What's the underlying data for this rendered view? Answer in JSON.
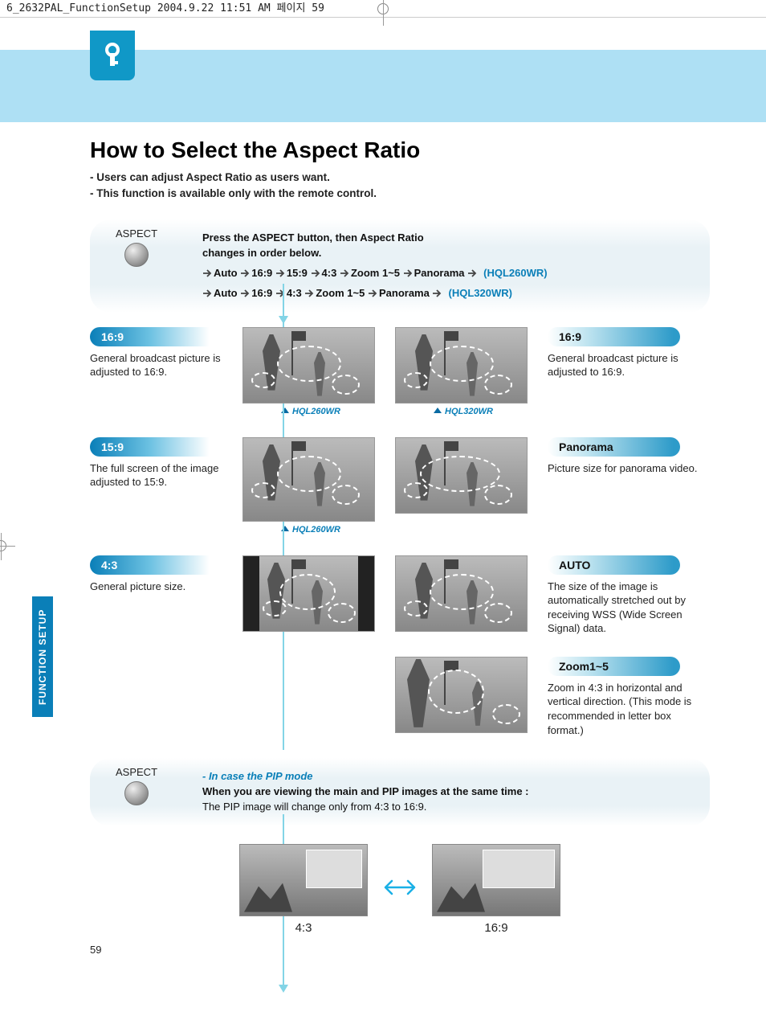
{
  "crop_mark": "6_2632PAL_FunctionSetup  2004.9.22 11:51 AM  페이지 59",
  "title": "How to Select the Aspect Ratio",
  "intro_l1": "- Users can adjust Aspect Ratio as users want.",
  "intro_l2": "- This function is available only with the remote control.",
  "aspect_label": "ASPECT",
  "panel1_l1": "Press the ASPECT button, then Aspect Ratio",
  "panel1_l2": "changes in order below.",
  "seq1": {
    "a": "Auto",
    "b": "16:9",
    "c": "15:9",
    "d": "4:3",
    "e": "Zoom 1~5",
    "f": "Panorama",
    "model": "(HQL260WR)"
  },
  "seq2": {
    "a": "Auto",
    "b": "16:9",
    "c": "4:3",
    "d": "Zoom 1~5",
    "e": "Panorama",
    "model": "(HQL320WR)"
  },
  "left": {
    "r1_t": "16:9",
    "r1_d": "General broadcast picture is adjusted to 16:9.",
    "r2_t": "15:9",
    "r2_d": "The full screen of the image adjusted to 15:9.",
    "r3_t": "4:3",
    "r3_d": "General picture size."
  },
  "right": {
    "r1_t": "16:9",
    "r1_d": "General broadcast picture is adjusted to 16:9.",
    "r2_t": "Panorama",
    "r2_d": "Picture size for panorama video.",
    "r3_t": "AUTO",
    "r3_d": "The size of the image is automatically stretched out by receiving WSS (Wide Screen Signal) data.",
    "r4_t": "Zoom1~5",
    "r4_d": "Zoom in 4:3 in horizontal and vertical direction. (This mode is recommended in letter box format.)"
  },
  "cap260": "HQL260WR",
  "cap320": "HQL320WR",
  "pip_head": "- In case the PIP mode",
  "pip_l1": "When you are viewing the main and PIP images at the same time :",
  "pip_l2": "The PIP image will change only from 4:3 to 16:9.",
  "pip_a": "4:3",
  "pip_b": "16:9",
  "sidetab": "FUNCTION SETUP",
  "page_no": "59"
}
